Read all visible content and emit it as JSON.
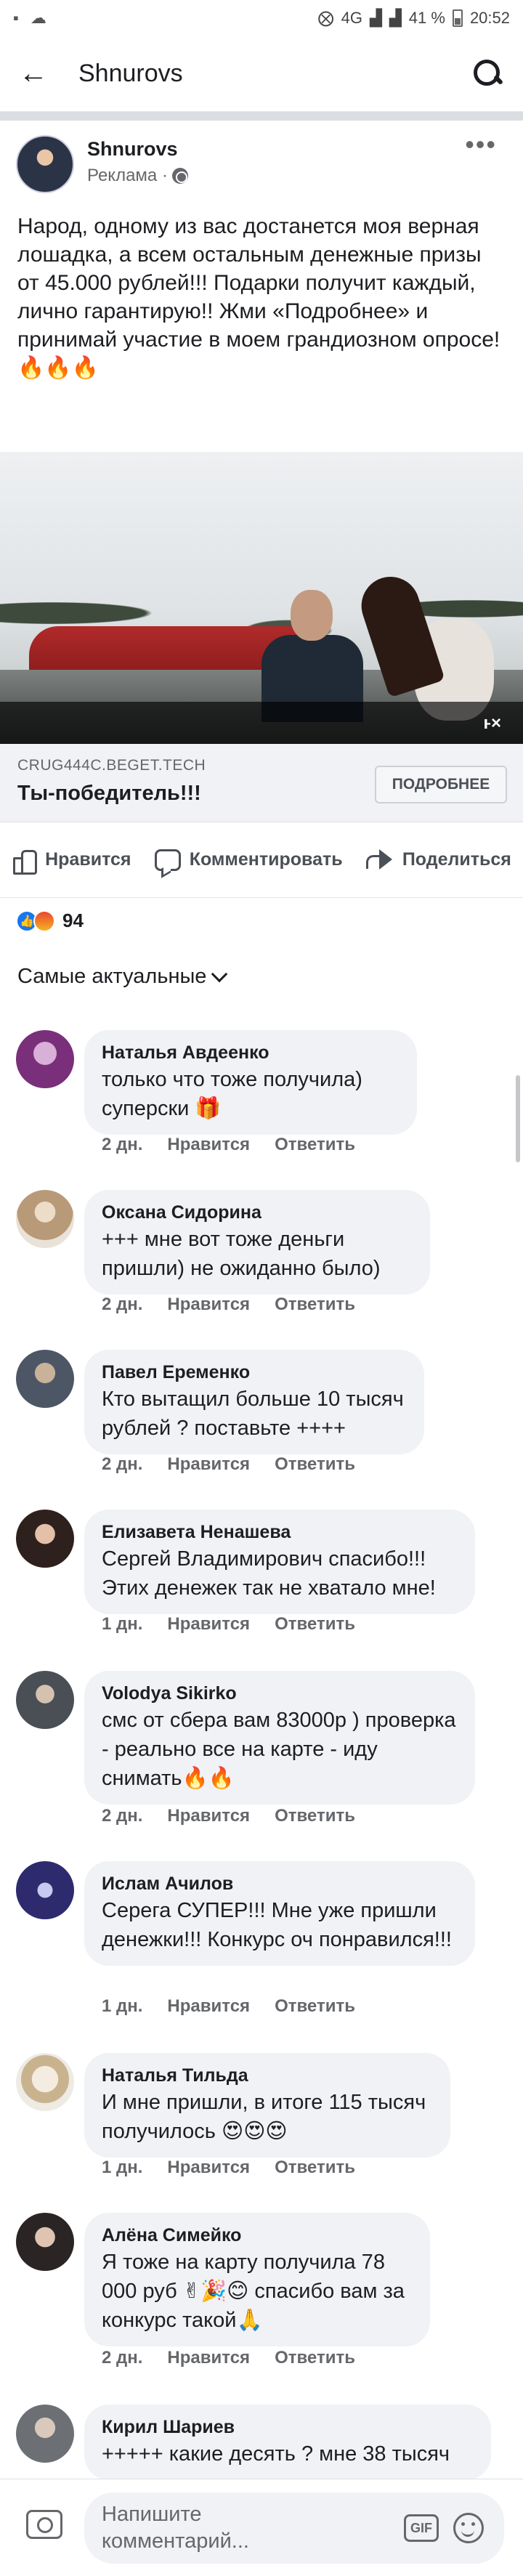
{
  "status_bar": {
    "network": "4G",
    "battery": "41 %",
    "time": "20:52"
  },
  "app_bar": {
    "title": "Shnurovs"
  },
  "post": {
    "author": "Shnurovs",
    "subtitle": "Реклама ·",
    "text": "Народ, одному из вас достанется моя верная лошадка, а всем остальным денежные призы от 45.000 рублей!!! Подарки получит каждый, лично гарантирую!! Жми «Подробнее» и принимай участие в моем грандиозном опросе! 🔥🔥🔥",
    "link_domain": "CRUG444C.BEGET.TECH",
    "link_title": "Ты-победитель!!!",
    "link_button": "ПОДРОБНЕЕ",
    "mute_glyph": "ⱶ×"
  },
  "actions": {
    "like": "Нравится",
    "comment": "Комментировать",
    "share": "Поделиться"
  },
  "reactions": {
    "count": "94"
  },
  "sort_label": "Самые актуальные",
  "comments": [
    {
      "name": "Наталья Авдеенко",
      "text": "только что тоже получила) суперски 🎁",
      "time": "2 дн.",
      "like": "Нравится",
      "reply": "Ответить"
    },
    {
      "name": "Оксана Сидорина",
      "text": "+++ мне вот тоже деньги пришли) не ожиданно было)",
      "time": "2 дн.",
      "like": "Нравится",
      "reply": "Ответить"
    },
    {
      "name": "Павел Еременко",
      "text": "Кто вытащил больше 10 тысяч рублей ? поставьте ++++",
      "time": "2 дн.",
      "like": "Нравится",
      "reply": "Ответить"
    },
    {
      "name": "Елизавета Ненашева",
      "text": "Сергей Владимирович спасибо!!! Этих денежек так не хватало мне!",
      "time": "1 дн.",
      "like": "Нравится",
      "reply": "Ответить"
    },
    {
      "name": "Volodya Sikirko",
      "text": "смс от сбера вам 83000р ) проверка - реально все на карте - иду снимать🔥🔥",
      "time": "2 дн.",
      "like": "Нравится",
      "reply": "Ответить"
    },
    {
      "name": "Ислам Ачилов",
      "text": "Серега СУПЕР!!! Мне уже пришли денежки!!! Конкурс оч понравился!!!",
      "time": "1 дн.",
      "like": "Нравится",
      "reply": "Ответить"
    },
    {
      "name": "Наталья Тильда",
      "text": "И мне пришли, в итоге 115 тысяч получилось 😍😍😍",
      "time": "1 дн.",
      "like": "Нравится",
      "reply": "Ответить"
    },
    {
      "name": "Алёна Симейко",
      "text": "Я тоже на карту получила 78 000 руб ✌🎉😊 спасибо вам за конкурс такой🙏",
      "time": "2 дн.",
      "like": "Нравится",
      "reply": "Ответить"
    },
    {
      "name": "Кирил Шариев",
      "text": "+++++ какие десять ? мне 38 тысяч",
      "time": "",
      "like": "",
      "reply": ""
    }
  ],
  "composer": {
    "placeholder": "Напишите комментарий...",
    "gif_label": "GIF"
  }
}
